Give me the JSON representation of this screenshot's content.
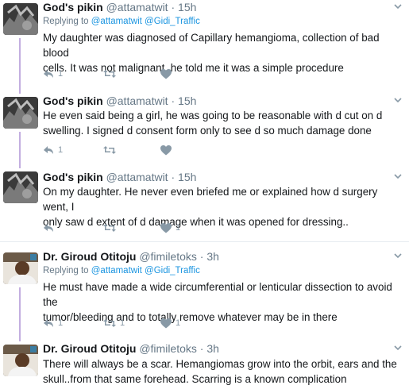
{
  "tweets": [
    {
      "name": "God's pikin",
      "handle": "@attamatwit",
      "dot": "·",
      "time": "15h",
      "replying_prefix": "Replying to",
      "replying_to": "@attamatwit @Gidi_Traffic",
      "text_line1": "My daughter was diagnosed of Capillary hemangioma, collection of bad blood",
      "text_line2": "cells. It was not malignant, he told me it was a simple procedure",
      "replies": "1",
      "retweets": "",
      "likes": ""
    },
    {
      "name": "God's pikin",
      "handle": "@attamatwit",
      "dot": "·",
      "time": "15h",
      "text_line1": "He even said being a girl, he was going to be reasonable with d cut on d",
      "text_line2": "swelling. I signed d consent form only to see d so much damage done",
      "replies": "1",
      "retweets": "",
      "likes": ""
    },
    {
      "name": "God's pikin",
      "handle": "@attamatwit",
      "dot": "·",
      "time": "15h",
      "text_line1": "On my daughter. He never even briefed me or explained how d surgery went, I",
      "text_line2": "only saw d extent of d damage when it was opened for dressing..",
      "replies": "",
      "retweets": "",
      "likes": "1"
    },
    {
      "name": "Dr. Giroud Otitoju",
      "handle": "@fimiletoks",
      "dot": "·",
      "time": "3h",
      "replying_prefix": "Replying to",
      "replying_to": "@attamatwit @Gidi_Traffic",
      "text_line1": "He must have made a wide circumferential or lenticular dissection to avoid the",
      "text_line2": "tumor/bleeding and to totally remove whatever may be in there",
      "replies": "1",
      "retweets": "1",
      "likes": "1"
    },
    {
      "name": "Dr. Giroud Otitoju",
      "handle": "@fimiletoks",
      "dot": "·",
      "time": "3h",
      "text_line1": "There will always be a scar. Hemangiomas grow into the orbit, ears and the",
      "text_line2": "skull..from that same forehead. Scarring is a known complication"
    }
  ],
  "icons": {
    "reply": "reply-icon",
    "retweet": "retweet-icon",
    "like": "heart-icon",
    "more": "chevron-down-icon"
  },
  "colors": {
    "thread_line": "#c3aee0",
    "link": "#1b95e0",
    "muted": "#657786",
    "action": "#8899a6"
  }
}
